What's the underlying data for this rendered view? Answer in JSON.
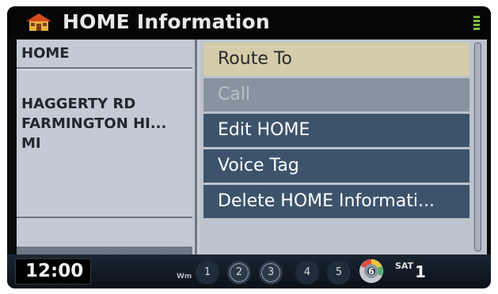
{
  "title_bar": {
    "title": "HOME Information",
    "icon": "home-icon"
  },
  "details": {
    "name": "HOME",
    "address_lines": [
      "HAGGERTY RD",
      "FARMINGTON HI...",
      "MI"
    ]
  },
  "menu": {
    "items": [
      {
        "label": "Route To",
        "state": "selected"
      },
      {
        "label": "Call",
        "state": "disabled"
      },
      {
        "label": "Edit HOME",
        "state": "normal"
      },
      {
        "label": "Voice Tag",
        "state": "normal"
      },
      {
        "label": "Delete HOME Informati...",
        "state": "normal"
      }
    ]
  },
  "status_bar": {
    "time": "12:00",
    "band_label": "Wm",
    "presets": [
      "1",
      "2",
      "3",
      "4",
      "5"
    ],
    "disc_number": "6",
    "sat_label": "SAT",
    "sat_channel": "1"
  },
  "colors": {
    "menu_selected": "#d4ccaa",
    "menu_normal": "#3c536b",
    "menu_disabled": "#8893a0",
    "panel": "#c3cad4"
  }
}
